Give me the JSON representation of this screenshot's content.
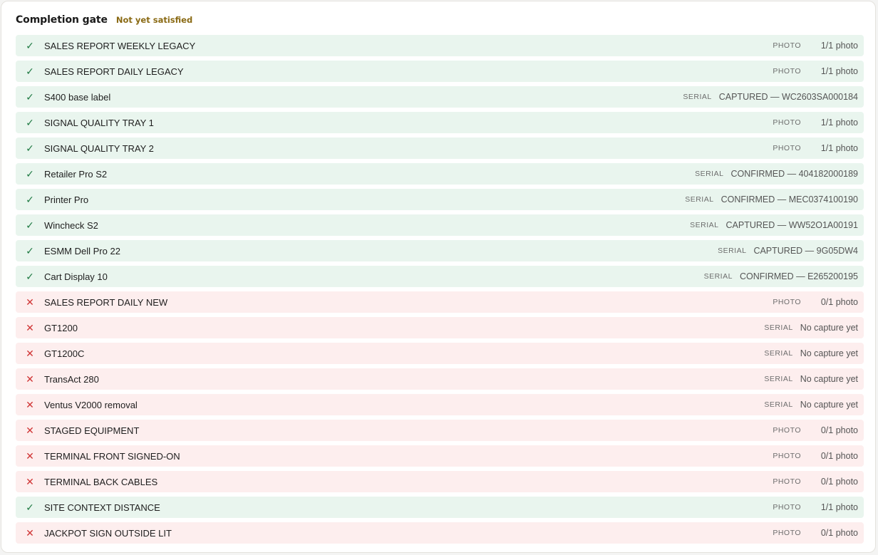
{
  "header": {
    "title": "Completion gate",
    "status": "Not yet satisfied"
  },
  "colors": {
    "ok_bg": "#e9f5ee",
    "ok_mark": "#1f7a43",
    "fail_bg": "#fdeeee",
    "fail_mark": "#d03535",
    "status_text": "#8a6a14"
  },
  "icons": {
    "ok": "check-icon",
    "fail": "x-icon"
  },
  "items": [
    {
      "label": "SALES REPORT WEEKLY LEGACY",
      "type": "PHOTO",
      "detail": "1/1 photo",
      "ok": true
    },
    {
      "label": "SALES REPORT DAILY LEGACY",
      "type": "PHOTO",
      "detail": "1/1 photo",
      "ok": true
    },
    {
      "label": "S400 base label",
      "type": "SERIAL",
      "detail": "CAPTURED — WC2603SA000184",
      "ok": true
    },
    {
      "label": "SIGNAL QUALITY TRAY 1",
      "type": "PHOTO",
      "detail": "1/1 photo",
      "ok": true
    },
    {
      "label": "SIGNAL QUALITY TRAY 2",
      "type": "PHOTO",
      "detail": "1/1 photo",
      "ok": true
    },
    {
      "label": "Retailer Pro S2",
      "type": "SERIAL",
      "detail": "CONFIRMED — 404182000189",
      "ok": true
    },
    {
      "label": "Printer Pro",
      "type": "SERIAL",
      "detail": "CONFIRMED — MEC0374100190",
      "ok": true
    },
    {
      "label": "Wincheck S2",
      "type": "SERIAL",
      "detail": "CAPTURED — WW52O1A00191",
      "ok": true
    },
    {
      "label": "ESMM Dell Pro 22",
      "type": "SERIAL",
      "detail": "CAPTURED — 9G05DW4",
      "ok": true
    },
    {
      "label": "Cart Display 10",
      "type": "SERIAL",
      "detail": "CONFIRMED — E265200195",
      "ok": true
    },
    {
      "label": "SALES REPORT DAILY NEW",
      "type": "PHOTO",
      "detail": "0/1 photo",
      "ok": false
    },
    {
      "label": "GT1200",
      "type": "SERIAL",
      "detail": "No capture yet",
      "ok": false
    },
    {
      "label": "GT1200C",
      "type": "SERIAL",
      "detail": "No capture yet",
      "ok": false
    },
    {
      "label": "TransAct 280",
      "type": "SERIAL",
      "detail": "No capture yet",
      "ok": false
    },
    {
      "label": "Ventus V2000 removal",
      "type": "SERIAL",
      "detail": "No capture yet",
      "ok": false
    },
    {
      "label": "STAGED EQUIPMENT",
      "type": "PHOTO",
      "detail": "0/1 photo",
      "ok": false
    },
    {
      "label": "TERMINAL FRONT SIGNED-ON",
      "type": "PHOTO",
      "detail": "0/1 photo",
      "ok": false
    },
    {
      "label": "TERMINAL BACK CABLES",
      "type": "PHOTO",
      "detail": "0/1 photo",
      "ok": false
    },
    {
      "label": "SITE CONTEXT DISTANCE",
      "type": "PHOTO",
      "detail": "1/1 photo",
      "ok": true
    },
    {
      "label": "JACKPOT SIGN OUTSIDE LIT",
      "type": "PHOTO",
      "detail": "0/1 photo",
      "ok": false
    }
  ]
}
